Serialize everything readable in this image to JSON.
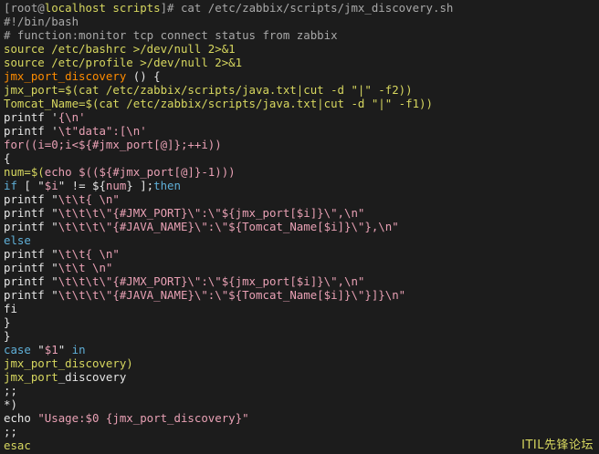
{
  "colors": {
    "background": "#1c1c1c",
    "white": "#e6e6e6",
    "gray": "#a8a8a8",
    "yellow": "#d7d75f",
    "orange": "#ff8c00",
    "pink": "#e8a0b4",
    "blue": "#5fafd7"
  },
  "terminal": {
    "lines": [
      [
        [
          "gray",
          "[root@"
        ],
        [
          "yellow",
          "localhost scripts"
        ],
        [
          "gray",
          "]# cat /etc/zabbix/scripts/jmx_discovery.sh"
        ]
      ],
      [
        [
          "gray",
          "#!/bin/bash"
        ]
      ],
      [
        [
          "gray",
          "# function:monitor tcp connect status from zabbix"
        ]
      ],
      [
        [
          "yellow",
          "source /etc/bashrc >/dev/null 2>&1"
        ]
      ],
      [
        [
          "yellow",
          "source /etc/profile >/dev/null 2>&1"
        ]
      ],
      [
        [
          "orange",
          "jmx_port_discovery"
        ],
        [
          "white",
          " () {"
        ]
      ],
      [
        [
          "yellow",
          "jmx_port=$(cat /etc/zabbix/scripts/java.txt|cut -d \"|\" -f2))"
        ]
      ],
      [
        [
          "yellow",
          "Tomcat_Name=$(cat /etc/zabbix/scripts/java.txt|cut -d \"|\" -f1))"
        ]
      ],
      [
        [
          "white",
          "printf '"
        ],
        [
          "pink",
          "{\\n'"
        ]
      ],
      [
        [
          "white",
          "printf '"
        ],
        [
          "pink",
          "\\t\"data\":[\\n'"
        ]
      ],
      [
        [
          "pink",
          "for((i=0;i<${#jmx_port[@]};++i))"
        ]
      ],
      [
        [
          "white",
          "{"
        ]
      ],
      [
        [
          "yellow",
          "num=$("
        ],
        [
          "pink",
          "echo $((${#jmx_port[@]}-1)))"
        ]
      ],
      [
        [
          "blue",
          "if"
        ],
        [
          "white",
          " [ \""
        ],
        [
          "pink",
          "$i"
        ],
        [
          "white",
          "\" != ${"
        ],
        [
          "pink",
          "num"
        ],
        [
          "white",
          "} ];"
        ],
        [
          "blue",
          "then"
        ]
      ],
      [
        [
          "white",
          "printf \""
        ],
        [
          "pink",
          "\\t\\t{ \\n\""
        ]
      ],
      [
        [
          "white",
          "printf \""
        ],
        [
          "pink",
          "\\t\\t\\t\\\"{#JMX_PORT}\\\":\\\"${jmx_port[$i]}\\\",\\n\""
        ]
      ],
      [
        [
          "white",
          "printf \""
        ],
        [
          "pink",
          "\\t\\t\\t\\\"{#JAVA_NAME}\\\":\\\"${Tomcat_Name[$i]}\\\"},\\n\""
        ]
      ],
      [
        [
          "blue",
          "else"
        ]
      ],
      [
        [
          "white",
          "printf \""
        ],
        [
          "pink",
          "\\t\\t{ \\n\""
        ]
      ],
      [
        [
          "white",
          "printf \""
        ],
        [
          "pink",
          "\\t\\t \\n\""
        ]
      ],
      [
        [
          "white",
          "printf \""
        ],
        [
          "pink",
          "\\t\\t\\t\\\"{#JMX_PORT}\\\":\\\"${jmx_port[$i]}\\\",\\n\""
        ]
      ],
      [
        [
          "white",
          "printf \""
        ],
        [
          "pink",
          "\\t\\t\\t\\\"{#JAVA_NAME}\\\":\\\"${Tomcat_Name[$i]}\\\"}]}\\n\""
        ]
      ],
      [
        [
          "white",
          "fi"
        ]
      ],
      [
        [
          "white",
          "}"
        ]
      ],
      [
        [
          "white",
          "}"
        ]
      ],
      [
        [
          "blue",
          "case"
        ],
        [
          "white",
          " \""
        ],
        [
          "pink",
          "$1"
        ],
        [
          "white",
          "\" "
        ],
        [
          "blue",
          "in"
        ]
      ],
      [
        [
          "yellow",
          "jmx_port_discovery)"
        ]
      ],
      [
        [
          "yellow",
          "jmx_port"
        ],
        [
          "white",
          "_discovery"
        ]
      ],
      [
        [
          "white",
          ";;"
        ]
      ],
      [
        [
          "white",
          "*)"
        ]
      ],
      [
        [
          "white",
          "echo "
        ],
        [
          "pink",
          "\"Usage:$0 {jmx_port_discovery}\""
        ]
      ],
      [
        [
          "white",
          ";;"
        ]
      ],
      [
        [
          "yellow",
          "esac"
        ]
      ]
    ]
  },
  "watermark": "ITIL先锋论坛"
}
